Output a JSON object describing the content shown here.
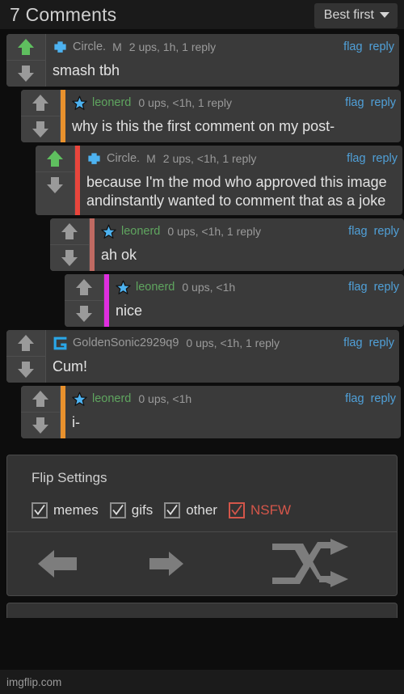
{
  "header": {
    "title": "7 Comments",
    "sort_label": "Best first",
    "sort_icon": "chevron-down-icon"
  },
  "comments": [
    {
      "level": 0,
      "avatar": "circle-blob-avatar",
      "username": "Circle.",
      "mod_badge": "M",
      "stats": "2 ups, 1h, 1 reply",
      "text": "smash tbh",
      "thread_color": "none",
      "upvoted": true,
      "flag_label": "flag",
      "reply_label": "reply"
    },
    {
      "level": 1,
      "avatar": "star-avatar",
      "username": "leonerd",
      "mod_badge": "",
      "stats": "0 ups, <1h, 1 reply",
      "text": "why is this the first comment on my post-",
      "thread_color": "#e8912d",
      "upvoted": false,
      "flag_label": "flag",
      "reply_label": "reply"
    },
    {
      "level": 2,
      "avatar": "circle-blob-avatar",
      "username": "Circle.",
      "mod_badge": "M",
      "stats": "2 ups, <1h, 1 reply",
      "text": "because I'm the mod who approved this image andinstantly wanted to comment that as a joke",
      "thread_color": "#e8453c",
      "upvoted": true,
      "flag_label": "flag",
      "reply_label": "reply"
    },
    {
      "level": 3,
      "avatar": "star-avatar",
      "username": "leonerd",
      "mod_badge": "",
      "stats": "0 ups, <1h, 1 reply",
      "text": "ah ok",
      "thread_color": "#c06a62",
      "upvoted": false,
      "flag_label": "flag",
      "reply_label": "reply"
    },
    {
      "level": 4,
      "avatar": "star-avatar",
      "username": "leonerd",
      "mod_badge": "",
      "stats": "0 ups, <1h",
      "text": "nice",
      "thread_color": "#e02ee0",
      "upvoted": false,
      "flag_label": "flag",
      "reply_label": "reply"
    },
    {
      "level": 0,
      "avatar": "g-letter-avatar",
      "username": "GoldenSonic2929q9",
      "mod_badge": "",
      "stats": "0 ups, <1h, 1 reply",
      "text": "Cum!",
      "thread_color": "none",
      "upvoted": false,
      "flag_label": "flag",
      "reply_label": "reply"
    },
    {
      "level": 1,
      "avatar": "star-avatar",
      "username": "leonerd",
      "mod_badge": "",
      "stats": "0 ups, <1h",
      "text": "i-",
      "thread_color": "#e8912d",
      "upvoted": false,
      "flag_label": "flag",
      "reply_label": "reply"
    }
  ],
  "flip_settings": {
    "title": "Flip Settings",
    "options": [
      {
        "label": "memes",
        "checked": true,
        "style": "normal"
      },
      {
        "label": "gifs",
        "checked": true,
        "style": "normal"
      },
      {
        "label": "other",
        "checked": true,
        "style": "normal"
      },
      {
        "label": "NSFW",
        "checked": true,
        "style": "nsfw"
      }
    ],
    "nav": {
      "prev_icon": "arrow-left-icon",
      "next_icon": "arrow-right-icon",
      "shuffle_icon": "shuffle-icon"
    }
  },
  "footer": {
    "watermark": "imgflip.com"
  },
  "colors": {
    "link": "#50a0d8",
    "username_green": "#5fa55f",
    "upvote_active": "#5fbf5f",
    "vote_inactive": "#9a9a9a",
    "nsfw": "#d4564a",
    "panel_bg": "#333333",
    "comment_bg": "#3a3a3a",
    "page_bg": "#0d0d0d"
  }
}
